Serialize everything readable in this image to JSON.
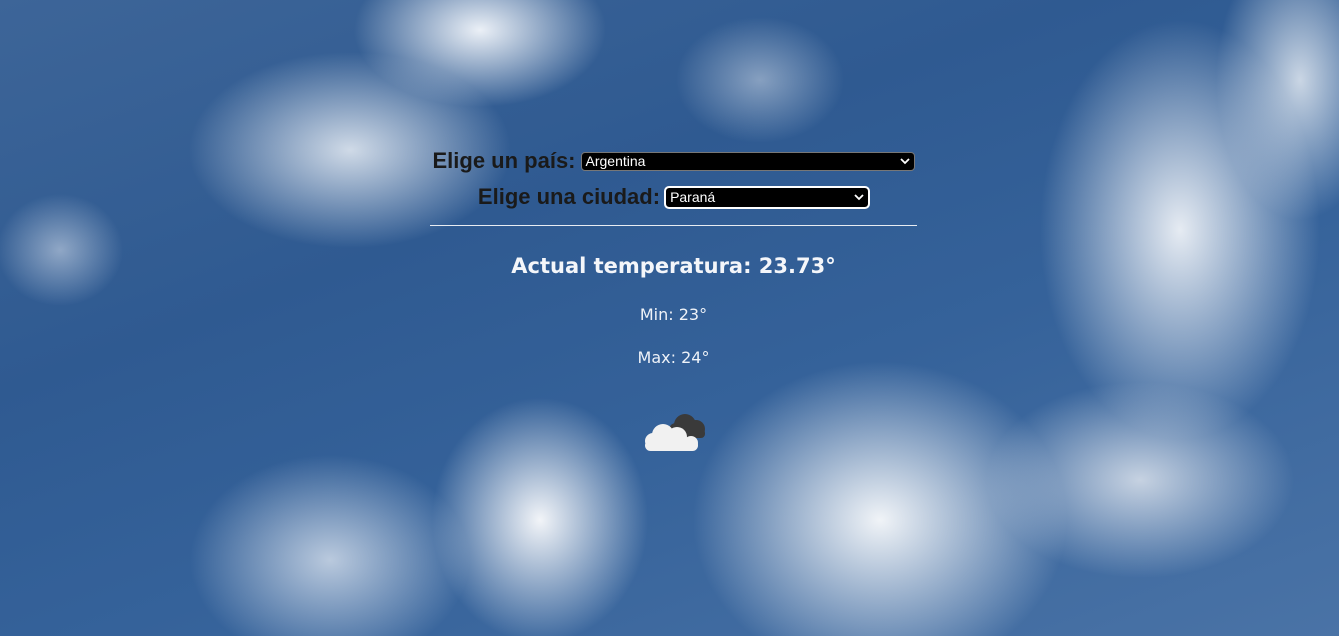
{
  "country": {
    "label": "Elige un país:",
    "selected": "Argentina"
  },
  "city": {
    "label": "Elige una ciudad:",
    "selected": "Paraná"
  },
  "weather": {
    "temp_label": "Actual temperatura: 23.73°",
    "min_label": "Min: 23°",
    "max_label": "Max: 24°",
    "icon": "cloud-icon"
  },
  "colors": {
    "select_bg": "#000000",
    "select_text": "#ffffff",
    "label_text": "#1a1a1a",
    "info_text": "#f4f6fa",
    "sky": "#2f5a91"
  }
}
